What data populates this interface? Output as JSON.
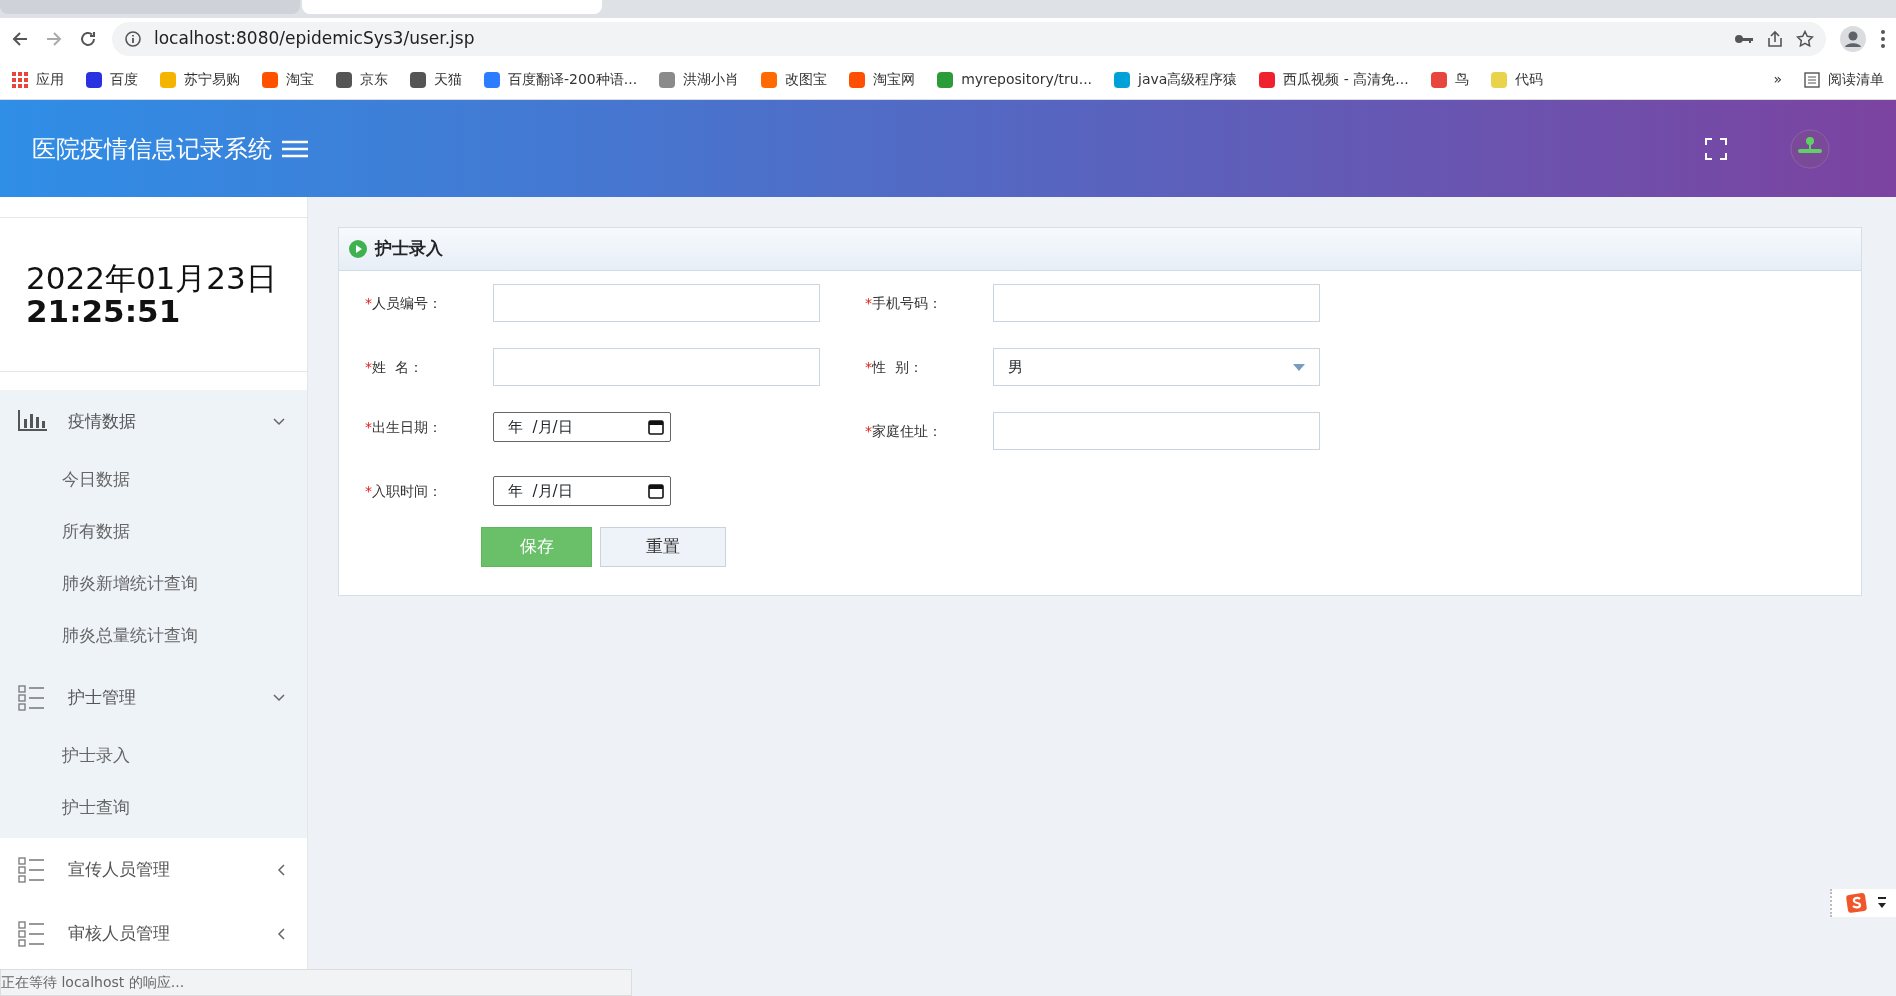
{
  "browser": {
    "url": "localhost:8080/epidemicSys3/user.jsp",
    "bookmarks": [
      {
        "label": "应用",
        "color": "#e8453c"
      },
      {
        "label": "百度",
        "color": "#2932e1"
      },
      {
        "label": "苏宁易购",
        "color": "#f5b400"
      },
      {
        "label": "淘宝",
        "color": "#ff5000"
      },
      {
        "label": "京东",
        "color": "#555555"
      },
      {
        "label": "天猫",
        "color": "#555555"
      },
      {
        "label": "百度翻译-200种语...",
        "color": "#2b7cff"
      },
      {
        "label": "洪湖小肖",
        "color": "#8a8a8a"
      },
      {
        "label": "改图宝",
        "color": "#ff6a00"
      },
      {
        "label": "淘宝网",
        "color": "#ff5000"
      },
      {
        "label": "myrepository/tru...",
        "color": "#2a9d3a"
      },
      {
        "label": "java高级程序猿",
        "color": "#00a1d6"
      },
      {
        "label": "西瓜视频 - 高清免...",
        "color": "#f0202c"
      },
      {
        "label": "鸟",
        "color": "#e8453c"
      },
      {
        "label": "代码",
        "color": "#e8d34a"
      }
    ],
    "overflow": "»",
    "reading_list": "阅读清单"
  },
  "header": {
    "title": "医院疫情信息记录系统"
  },
  "sidebar": {
    "date": "2022年01月23日",
    "time": "21:25:51",
    "menu": [
      {
        "label": "疫情数据",
        "kind": "chart",
        "expanded": true,
        "children": [
          {
            "label": "今日数据"
          },
          {
            "label": "所有数据"
          },
          {
            "label": "肺炎新增统计查询"
          },
          {
            "label": "肺炎总量统计查询"
          }
        ]
      },
      {
        "label": "护士管理",
        "kind": "list",
        "expanded": true,
        "children": [
          {
            "label": "护士录入"
          },
          {
            "label": "护士查询"
          }
        ]
      },
      {
        "label": "宣传人员管理",
        "kind": "list",
        "expanded": false
      },
      {
        "label": "审核人员管理",
        "kind": "list",
        "expanded": false
      }
    ]
  },
  "form": {
    "title": "护士录入",
    "fields": [
      {
        "required_mark": "*",
        "label": "人员编号：",
        "kind": "text"
      },
      {
        "required_mark": "*",
        "label": "手机号码：",
        "kind": "text"
      },
      {
        "required_mark": "*",
        "label": "姓  名：",
        "kind": "text"
      },
      {
        "required_mark": "*",
        "label": "性  别：",
        "kind": "select",
        "value": "男"
      },
      {
        "required_mark": "*",
        "label": "出生日期：",
        "kind": "date",
        "value": "年  /月/日"
      },
      {
        "required_mark": "*",
        "label": "家庭住址：",
        "kind": "text"
      },
      {
        "required_mark": "*",
        "label": "入职时间：",
        "kind": "date",
        "value": "年  /月/日"
      }
    ],
    "buttons": [
      {
        "label": "保存",
        "kind": "primary"
      },
      {
        "label": "重置",
        "kind": "secondary"
      }
    ]
  },
  "status_bar": {
    "text": "正在等待 localhost 的响应..."
  }
}
